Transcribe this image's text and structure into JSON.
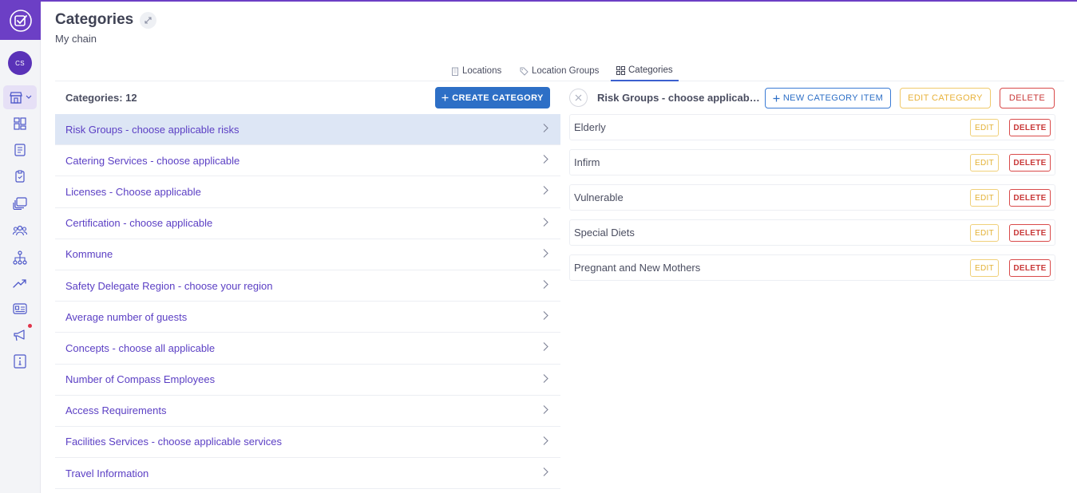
{
  "page": {
    "title": "Categories",
    "subtitle": "My chain"
  },
  "sidebar": {
    "avatar_initials": "CS",
    "icons": [
      "check-square-icon",
      "store-icon",
      "dashboard-icon",
      "checklist-book-icon",
      "clipboard-icon",
      "stack-cards-icon",
      "users-icon",
      "hierarchy-icon",
      "trend-up-icon",
      "id-card-icon",
      "megaphone-icon",
      "info-icon"
    ],
    "accent_color": "#6c3fc5",
    "notification_dot_color": "#e0344a"
  },
  "tabs": [
    {
      "label": "Locations",
      "icon": "building-icon",
      "active": false
    },
    {
      "label": "Location Groups",
      "icon": "tags-icon",
      "active": false
    },
    {
      "label": "Categories",
      "icon": "grid-icon",
      "active": true
    }
  ],
  "left_panel": {
    "count_label": "Categories: 12",
    "create_button_label": "CREATE CATEGORY",
    "categories": [
      {
        "label": "Risk Groups - choose applicable risks",
        "selected": true
      },
      {
        "label": "Catering Services - choose applicable",
        "selected": false
      },
      {
        "label": "Licenses - Choose applicable",
        "selected": false
      },
      {
        "label": "Certification - choose applicable",
        "selected": false
      },
      {
        "label": "Kommune",
        "selected": false
      },
      {
        "label": "Safety Delegate Region - choose your region",
        "selected": false
      },
      {
        "label": "Average number of guests",
        "selected": false
      },
      {
        "label": "Concepts - choose all applicable",
        "selected": false
      },
      {
        "label": "Number of Compass Employees",
        "selected": false
      },
      {
        "label": "Access Requirements",
        "selected": false
      },
      {
        "label": "Facilities Services - choose applicable services",
        "selected": false
      },
      {
        "label": "Travel Information",
        "selected": false
      }
    ]
  },
  "right_panel": {
    "selected_title": "Risk Groups - choose applicable risks",
    "new_item_label": "NEW CATEGORY ITEM",
    "edit_category_label": "EDIT CATEGORY",
    "delete_label": "DELETE",
    "items": [
      {
        "label": "Elderly",
        "edit": "EDIT",
        "delete": "DELETE"
      },
      {
        "label": "Infirm",
        "edit": "EDIT",
        "delete": "DELETE"
      },
      {
        "label": "Vulnerable",
        "edit": "EDIT",
        "delete": "DELETE"
      },
      {
        "label": "Special Diets",
        "edit": "EDIT",
        "delete": "DELETE"
      },
      {
        "label": "Pregnant and New Mothers",
        "edit": "EDIT",
        "delete": "DELETE"
      }
    ]
  },
  "colors": {
    "primary_blue": "#2d6fc6",
    "link_purple": "#5b3fc4",
    "selected_row_bg": "#dde6f5",
    "edit_yellow": "#e8b23a",
    "delete_red": "#c93a3a"
  }
}
